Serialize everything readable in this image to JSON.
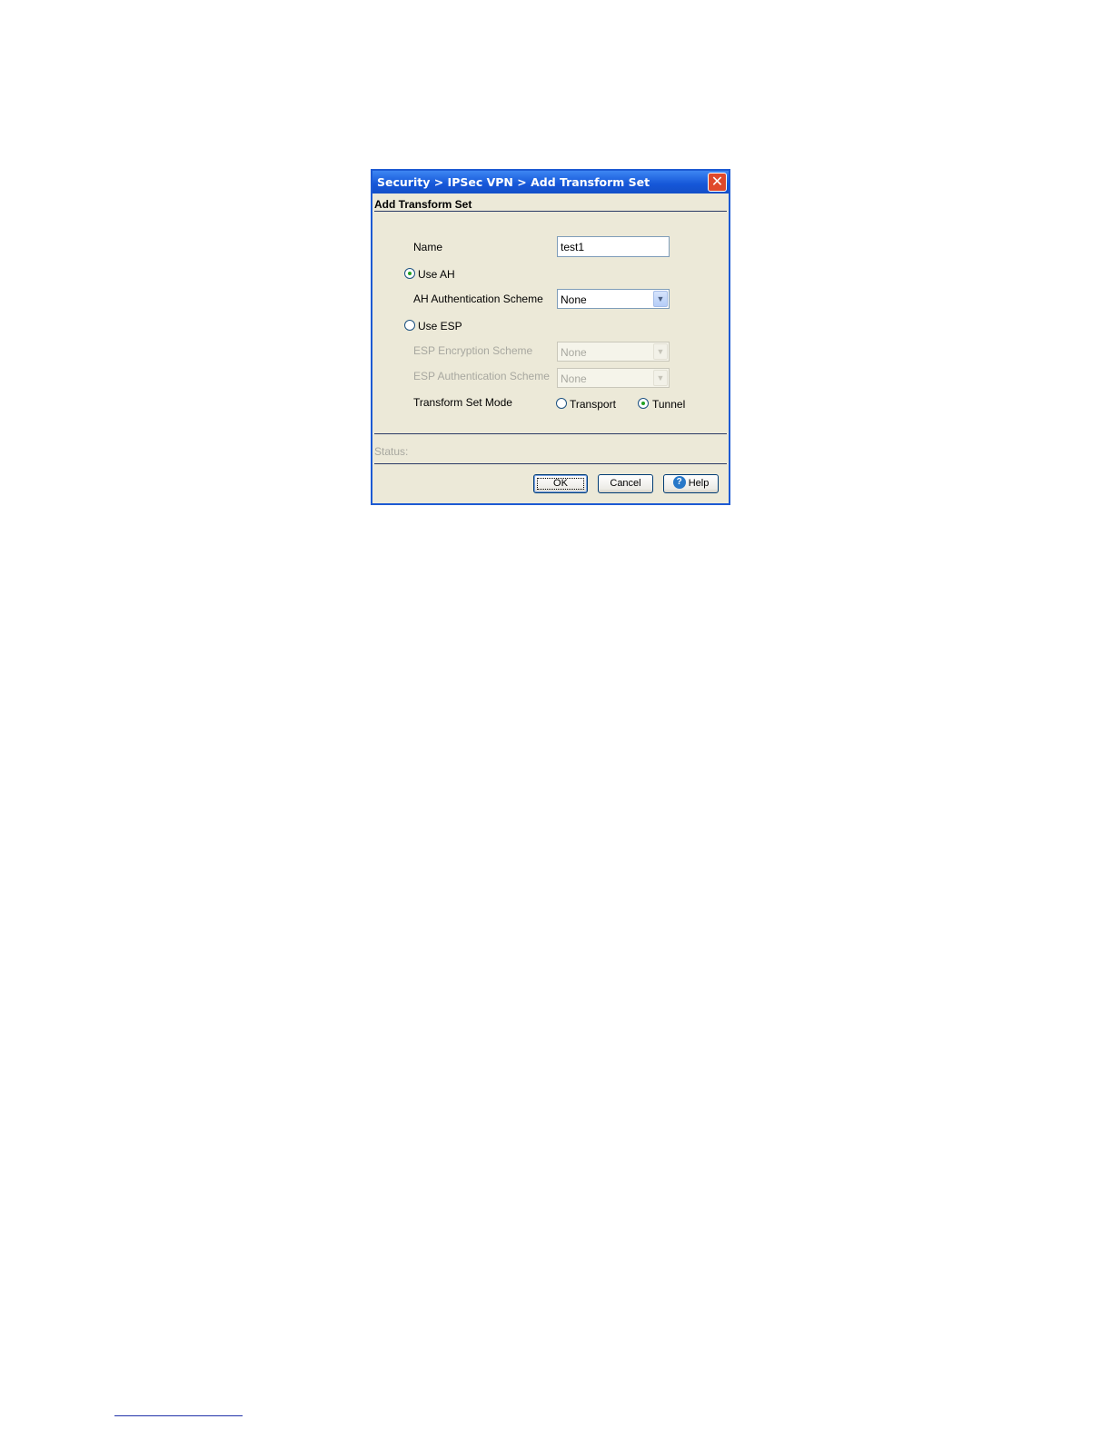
{
  "dialog": {
    "title": "Security > IPSec VPN > Add Transform Set",
    "close_symbol": "✕",
    "section_header": "Add Transform Set",
    "name_label": "Name",
    "name_value": "test1",
    "use_ah_label": "Use AH",
    "use_ah_checked": true,
    "ah_auth_label": "AH Authentication Scheme",
    "ah_auth_value": "None",
    "use_esp_label": "Use ESP",
    "use_esp_checked": false,
    "esp_enc_label": "ESP Encryption Scheme",
    "esp_enc_value": "None",
    "esp_auth_label": "ESP Authentication Scheme",
    "esp_auth_value": "None",
    "mode_label": "Transform Set Mode",
    "mode_transport_label": "Transport",
    "mode_tunnel_label": "Tunnel",
    "mode_selected": "Tunnel",
    "status_label": "Status:",
    "buttons": {
      "ok": "OK",
      "cancel": "Cancel",
      "help": "Help",
      "help_icon_glyph": "?"
    },
    "dropdown_arrow": "▼"
  },
  "icons": {
    "close": "close-icon",
    "help": "help-icon",
    "dropdown": "chevron-down-icon"
  },
  "colors": {
    "titlebar": "#1556d8",
    "dialog_bg": "#ece9d8",
    "close_button": "#e0492b",
    "radio_dot": "#21a121",
    "disabled_text": "#a8a8a0"
  }
}
